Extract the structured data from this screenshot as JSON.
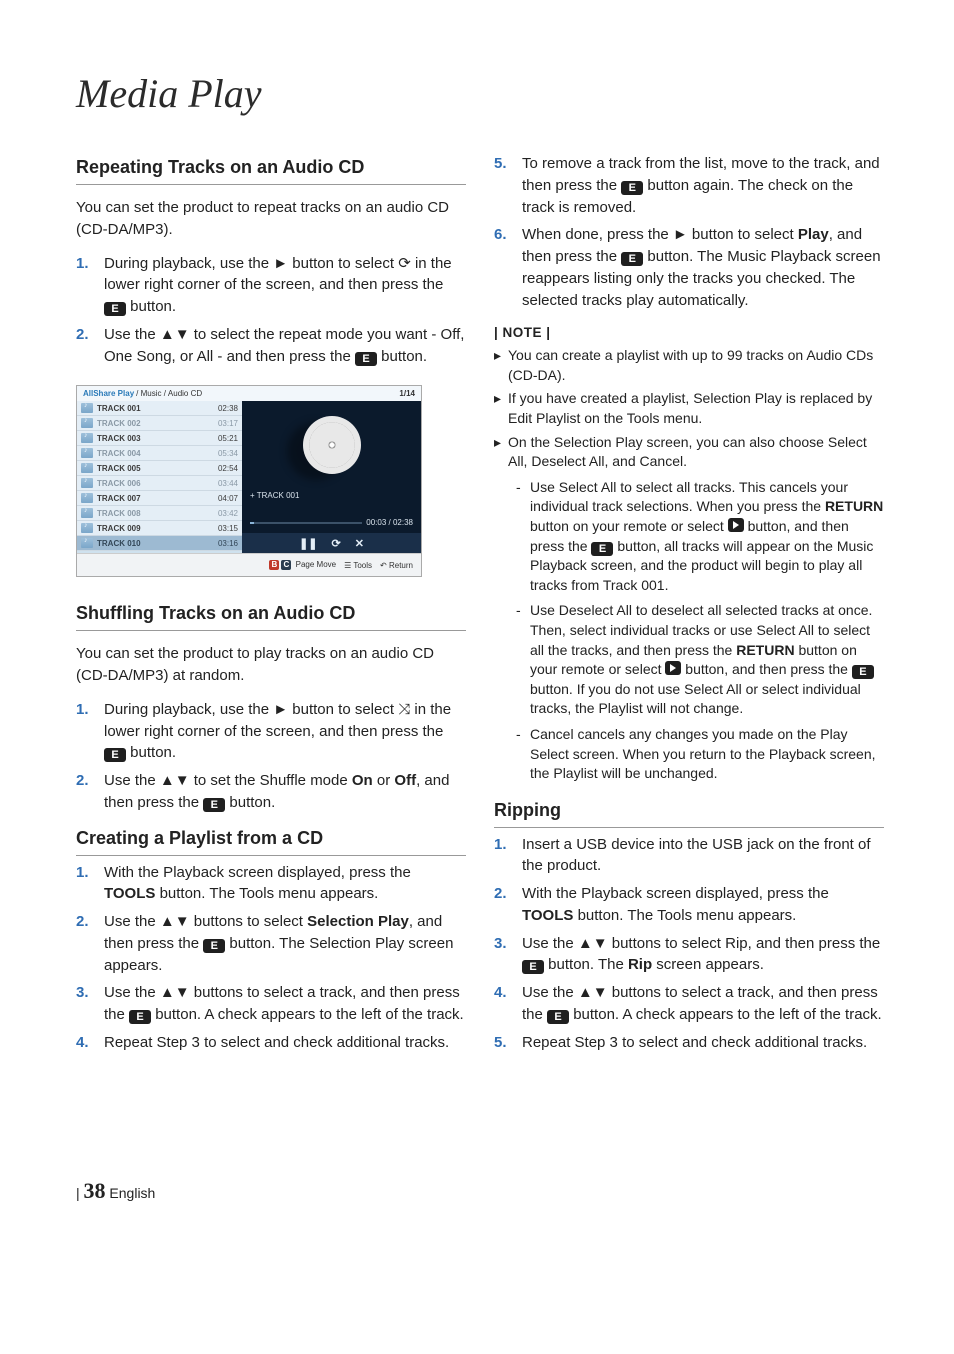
{
  "page_title": "Media Play",
  "section_repeat": {
    "heading": "Repeating Tracks on an Audio CD",
    "lead": "You can set the product to repeat tracks on an audio CD (CD-DA/MP3).",
    "step1_a": "During playback, use the ► button to select ",
    "step1_b": " in the lower right corner of the screen, and then press the ",
    "step1_c": " button.",
    "step2_a": "Use the ▲▼ to select the repeat mode you want - Off, One Song, or All - and then press the ",
    "step2_b": " button."
  },
  "figure": {
    "breadcrumb_allshare": "AllShare Play",
    "breadcrumb_music": "/ Music /",
    "breadcrumb_audio": "Audio CD",
    "page_indicator": "1/14",
    "tracks": [
      {
        "name": "TRACK 001",
        "dur": "02:38",
        "alt": false
      },
      {
        "name": "TRACK 002",
        "dur": "03:17",
        "alt": true
      },
      {
        "name": "TRACK 003",
        "dur": "05:21",
        "alt": false
      },
      {
        "name": "TRACK 004",
        "dur": "05:34",
        "alt": true
      },
      {
        "name": "TRACK 005",
        "dur": "02:54",
        "alt": false
      },
      {
        "name": "TRACK 006",
        "dur": "03:44",
        "alt": true
      },
      {
        "name": "TRACK 007",
        "dur": "04:07",
        "alt": false
      },
      {
        "name": "TRACK 008",
        "dur": "03:42",
        "alt": true
      },
      {
        "name": "TRACK 009",
        "dur": "03:15",
        "alt": false
      },
      {
        "name": "TRACK 010",
        "dur": "03:16",
        "alt": true
      }
    ],
    "now_playing": "+ TRACK 001",
    "time": "00:03 / 02:38",
    "footer_pagemove": "Page Move",
    "footer_tools": "Tools",
    "footer_return": "Return"
  },
  "section_shuffle": {
    "heading": "Shuffling Tracks on an Audio CD",
    "lead": "You can set the product to play tracks on an audio CD (CD-DA/MP3) at random.",
    "step1_a": "During playback, use the ► button to select ",
    "step1_b": " in the lower right corner of the screen, and then press the ",
    "step1_c": " button.",
    "step2_a": "Use the ▲▼ to set the Shuffle mode ",
    "step2_on": "On",
    "step2_or": " or ",
    "step2_off": "Off",
    "step2_c": ", and then press the ",
    "step2_d": " button."
  },
  "section_playlist": {
    "heading": "Creating a Playlist from a CD",
    "step1_a": "With the Playback screen displayed, press the ",
    "step1_tools": "TOOLS",
    "step1_b": " button. The Tools menu appears.",
    "step2_a": "Use the ▲▼ buttons to select ",
    "step2_sel": "Selection Play",
    "step2_b": ", and then press the ",
    "step2_c": " button. The Selection Play screen appears.",
    "step3_a": "Use the ▲▼ buttons to select a track, and then press the ",
    "step3_b": " button. A check appears to the left of the track.",
    "step4": "Repeat Step 3 to select and check additional tracks.",
    "step5_a": "To remove a track from the list, move to the track, and then press the ",
    "step5_b": " button again. The check on the track is removed.",
    "step6_a": "When done, press the ► button to select ",
    "step6_play": "Play",
    "step6_b": ", and then press the ",
    "step6_c": " button. The Music Playback screen reappears listing only the tracks you checked. The selected tracks play automatically."
  },
  "note_label": "| NOTE |",
  "notes": {
    "n1": "You can create a playlist with up to 99 tracks on Audio CDs (CD-DA).",
    "n2": "If you have created a playlist, Selection Play is replaced by Edit Playlist on the Tools menu.",
    "n3": "On the Selection Play screen, you can also choose Select All, Deselect All, and Cancel.",
    "s1_a": "Use Select All to select all tracks. This cancels your individual track selections. When you press the ",
    "s1_return": "RETURN",
    "s1_b": " button on your remote or select ",
    "s1_c": " button, and then press the ",
    "s1_d": " button, all tracks will appear on the Music Playback screen, and the product will begin to play all tracks from Track 001.",
    "s2_a": "Use Deselect All to deselect all selected tracks at once. Then, select individual tracks or use Select All to select all the tracks, and then press the ",
    "s2_return": "RETURN",
    "s2_b": " button on your remote or select ",
    "s2_c": " button, and then press the ",
    "s2_d": " button. If you do not use Select All or select individual tracks, the Playlist will not change.",
    "s3": "Cancel cancels any changes you made on the Play Select screen. When you return to the Playback screen, the Playlist will be unchanged."
  },
  "section_rip": {
    "heading": "Ripping",
    "step1": "Insert a USB device into the USB jack on the front of the product.",
    "step2_a": "With the Playback screen displayed, press the ",
    "step2_tools": "TOOLS",
    "step2_b": " button. The Tools menu appears.",
    "step3_a": "Use the ▲▼ buttons to select Rip, and then press the ",
    "step3_b": " button. The ",
    "step3_rip": "Rip",
    "step3_c": " screen appears.",
    "step4_a": "Use the ▲▼ buttons to select a track, and then press the ",
    "step4_b": " button. A check appears to the left of the track.",
    "step5": "Repeat Step 3 to select and check additional tracks."
  },
  "footer": {
    "sep": "| ",
    "page": "38",
    "lang": " English"
  }
}
